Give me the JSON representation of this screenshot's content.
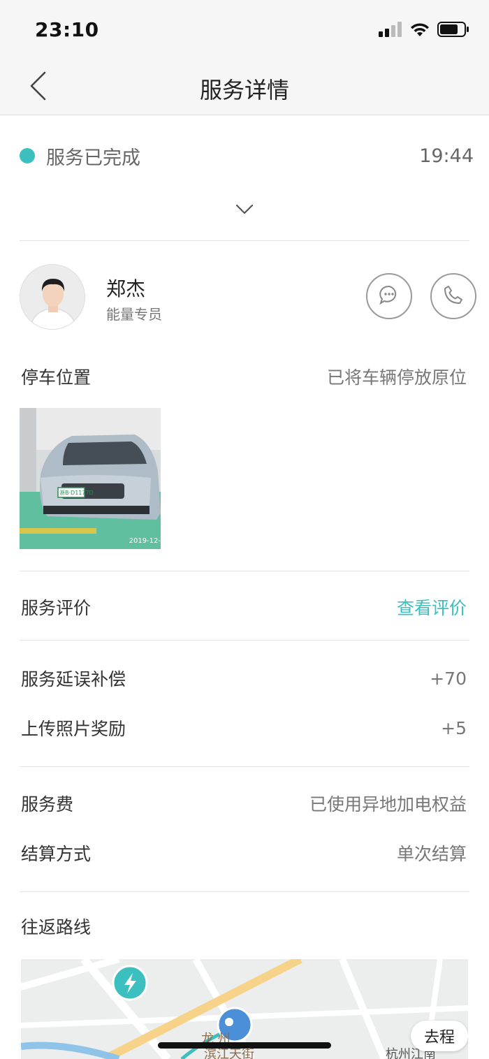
{
  "status_bar": {
    "time": "23:10"
  },
  "nav": {
    "title": "服务详情"
  },
  "service_status": {
    "text": "服务已完成",
    "time": "19:44",
    "dot_color": "#3bbfbf"
  },
  "staff": {
    "name": "郑杰",
    "role": "能量专员"
  },
  "parking": {
    "label": "停车位置",
    "value": "已将车辆停放原位",
    "plate": "浙B·D1177D",
    "photo_date": "2019-12-"
  },
  "rating": {
    "label": "服务评价",
    "value": "查看评价"
  },
  "compensation": {
    "label": "服务延误补偿",
    "value": "+70"
  },
  "photo_reward": {
    "label": "上传照片奖励",
    "value": "+5"
  },
  "fee": {
    "label": "服务费",
    "value": "已使用异地加电权益"
  },
  "settlement": {
    "label": "结算方式",
    "value": "单次结算"
  },
  "route": {
    "label": "往返路线",
    "trip_button": "去程",
    "map_labels": {
      "street_top": "龙  州",
      "street_bottom": "滨江天街",
      "district": "杭州江南"
    }
  },
  "colors": {
    "accent": "#3bbfbf",
    "map_marker": "#3bbfbf",
    "map_car_marker": "#4a8fd8"
  }
}
